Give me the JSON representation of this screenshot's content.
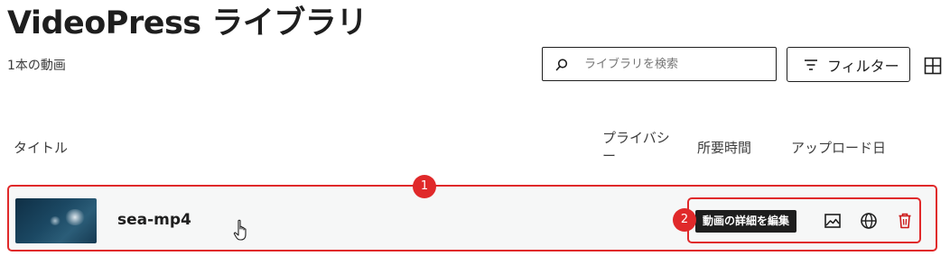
{
  "header": {
    "title": "VideoPress ライブラリ",
    "count_text": "1本の動画"
  },
  "search": {
    "placeholder": "ライブラリを検索",
    "icon": "search-icon"
  },
  "toolbar": {
    "filter_label": "フィルター",
    "filter_icon": "filter-lines-icon",
    "grid_toggle_icon": "grid-view-icon"
  },
  "table": {
    "columns": {
      "title": "タイトル",
      "privacy_line1": "プライバシ",
      "privacy_line2": "ー",
      "duration": "所要時間",
      "upload_date": "アップロード日"
    },
    "rows": [
      {
        "title": "sea-mp4",
        "thumbnail": "ocean-video-thumbnail"
      }
    ]
  },
  "row_actions": {
    "edit_tooltip": "動画の詳細を編集",
    "icons": [
      "image-icon",
      "globe-icon",
      "trash-icon"
    ]
  },
  "annotations": {
    "marker_1": "1",
    "marker_2": "2"
  },
  "colors": {
    "highlight": "#e0292a",
    "text": "#1e1e1e",
    "row_background": "#f6f7f7",
    "delete_red": "#cc1818"
  }
}
